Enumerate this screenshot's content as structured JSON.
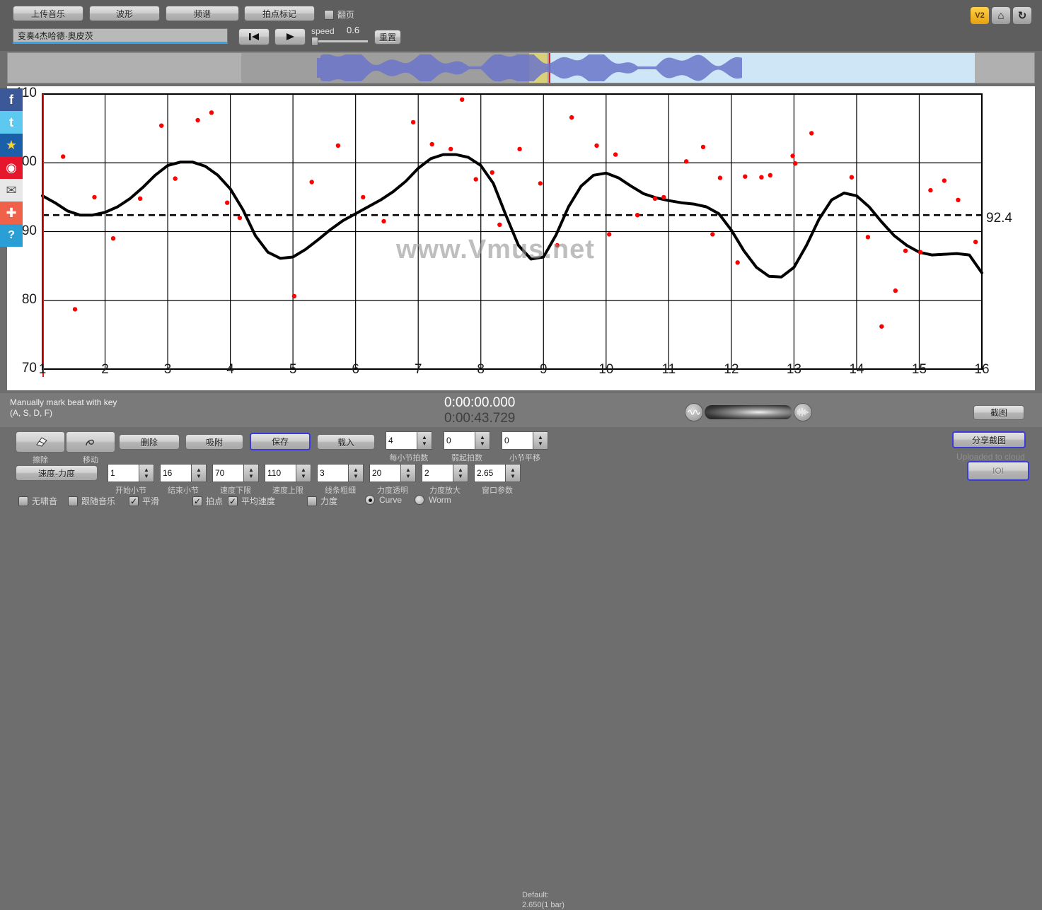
{
  "toolbar": {
    "tabs": [
      {
        "label": "上传音乐",
        "name": "upload-music"
      },
      {
        "label": "波形",
        "name": "waveform"
      },
      {
        "label": "频谱",
        "name": "spectrum"
      },
      {
        "label": "拍点标记",
        "name": "beat-marker"
      }
    ],
    "page_turn_label": "翻页",
    "page_turn_checked": false,
    "track_title": "变奏4杰哈德·奥皮茨",
    "speed_label": "speed",
    "speed_value": "0.6",
    "reset_label": "重置",
    "corner_v2": "V2",
    "corner_home": "⌂",
    "corner_refresh": "↻"
  },
  "status": {
    "hint_line1": "Manually mark beat with key",
    "hint_line2": "(A, S, D, F)",
    "time_current": "0:00:00.000",
    "time_total": "0:00:43.729",
    "snapshot_label": "截图"
  },
  "tools": [
    {
      "label": "擦除",
      "name": "erase",
      "icon": "eraser-icon"
    },
    {
      "label": "移动",
      "name": "move",
      "icon": "move-icon"
    }
  ],
  "buttons": {
    "delete": "删除",
    "snap": "吸附",
    "save": "保存",
    "load": "载入",
    "tempo_dynamics": "速度-力度",
    "share_snapshot": "分享截图",
    "uploaded": "Uploaded to cloud",
    "ioi": "IOI"
  },
  "spinners_row1": [
    {
      "name": "beats-per-bar",
      "value": "4",
      "caption": "每小节拍数"
    },
    {
      "name": "pickup-beats",
      "value": "0",
      "caption": "弱起拍数"
    },
    {
      "name": "bar-shift",
      "value": "0",
      "caption": "小节平移"
    }
  ],
  "spinners_row2": [
    {
      "name": "start-bar",
      "value": "1",
      "caption": "开始小节"
    },
    {
      "name": "end-bar",
      "value": "16",
      "caption": "结束小节"
    },
    {
      "name": "tempo-min",
      "value": "70",
      "caption": "速度下限"
    },
    {
      "name": "tempo-max",
      "value": "110",
      "caption": "速度上限"
    },
    {
      "name": "line-thickness",
      "value": "3",
      "caption": "线条粗细"
    },
    {
      "name": "dynamics-opacity",
      "value": "20",
      "caption": "力度透明"
    },
    {
      "name": "dynamics-scale",
      "value": "2",
      "caption": "力度放大"
    },
    {
      "name": "window-param",
      "value": "2.65",
      "caption": "窗口参数"
    }
  ],
  "default_note_line1": "Default:",
  "default_note_line2": "2.650(1 bar)",
  "checkboxes": [
    {
      "name": "no-whistle",
      "label": "无啸音",
      "checked": false
    },
    {
      "name": "follow-music",
      "label": "跟随音乐",
      "checked": false
    },
    {
      "name": "smooth",
      "label": "平滑",
      "checked": true
    },
    {
      "name": "beat",
      "label": "拍点",
      "checked": true
    },
    {
      "name": "average-tempo",
      "label": "平均速度",
      "checked": true
    },
    {
      "name": "dynamics",
      "label": "力度",
      "checked": false
    }
  ],
  "radios": [
    {
      "name": "curve",
      "label": "Curve",
      "selected": true
    },
    {
      "name": "worm",
      "label": "Worm",
      "selected": false
    }
  ],
  "social": [
    {
      "name": "facebook-icon",
      "glyph": "f",
      "color": "#3b5998"
    },
    {
      "name": "twitter-icon",
      "glyph": "t",
      "color": "#5ec9f0"
    },
    {
      "name": "qzone-icon",
      "glyph": "★",
      "color": "#1b5fa8"
    },
    {
      "name": "weibo-icon",
      "glyph": "◉",
      "color": "#e6162d"
    },
    {
      "name": "email-icon",
      "glyph": "✉",
      "color": "#e8e8e8"
    },
    {
      "name": "gplus-icon",
      "glyph": "✚",
      "color": "#f0614a"
    },
    {
      "name": "help-icon",
      "glyph": "?",
      "color": "#2a9fd6"
    }
  ],
  "watermark": "www.Vmus.net",
  "chart_data": {
    "type": "line",
    "title": "",
    "xlabel": "",
    "ylabel": "",
    "xlim": [
      1,
      16
    ],
    "ylim": [
      70,
      110
    ],
    "grid": true,
    "legend": "none",
    "xticks": [
      1,
      2,
      3,
      4,
      5,
      6,
      7,
      8,
      9,
      10,
      11,
      12,
      13,
      14,
      15,
      16
    ],
    "yticks": [
      70,
      80,
      90,
      100,
      110
    ],
    "mean_line": {
      "value": 92.4,
      "label": "92.4",
      "style": "dashed",
      "color": "#000000"
    },
    "series": [
      {
        "name": "tempo-curve",
        "type": "line",
        "color": "#000000",
        "points": [
          [
            1.0,
            95.2
          ],
          [
            1.2,
            94.2
          ],
          [
            1.4,
            93.0
          ],
          [
            1.6,
            92.4
          ],
          [
            1.8,
            92.4
          ],
          [
            2.0,
            92.8
          ],
          [
            2.2,
            93.6
          ],
          [
            2.4,
            94.8
          ],
          [
            2.6,
            96.4
          ],
          [
            2.8,
            98.2
          ],
          [
            3.0,
            99.6
          ],
          [
            3.2,
            100.1
          ],
          [
            3.4,
            100.1
          ],
          [
            3.6,
            99.5
          ],
          [
            3.8,
            98.2
          ],
          [
            4.0,
            96.2
          ],
          [
            4.2,
            93.2
          ],
          [
            4.4,
            89.4
          ],
          [
            4.6,
            87.0
          ],
          [
            4.8,
            86.1
          ],
          [
            5.0,
            86.3
          ],
          [
            5.2,
            87.4
          ],
          [
            5.4,
            88.8
          ],
          [
            5.6,
            90.3
          ],
          [
            5.8,
            91.6
          ],
          [
            6.0,
            92.6
          ],
          [
            6.2,
            93.6
          ],
          [
            6.4,
            94.6
          ],
          [
            6.6,
            95.8
          ],
          [
            6.8,
            97.3
          ],
          [
            7.0,
            99.2
          ],
          [
            7.2,
            100.6
          ],
          [
            7.4,
            101.2
          ],
          [
            7.6,
            101.2
          ],
          [
            7.8,
            100.8
          ],
          [
            8.0,
            99.6
          ],
          [
            8.2,
            97.0
          ],
          [
            8.4,
            92.4
          ],
          [
            8.6,
            88.0
          ],
          [
            8.8,
            86.0
          ],
          [
            9.0,
            86.3
          ],
          [
            9.2,
            89.5
          ],
          [
            9.4,
            93.6
          ],
          [
            9.6,
            96.6
          ],
          [
            9.8,
            98.2
          ],
          [
            10.0,
            98.5
          ],
          [
            10.2,
            97.8
          ],
          [
            10.4,
            96.6
          ],
          [
            10.6,
            95.5
          ],
          [
            10.8,
            94.9
          ],
          [
            11.0,
            94.5
          ],
          [
            11.2,
            94.2
          ],
          [
            11.4,
            94.0
          ],
          [
            11.6,
            93.6
          ],
          [
            11.8,
            92.6
          ],
          [
            12.0,
            90.2
          ],
          [
            12.2,
            87.2
          ],
          [
            12.4,
            84.8
          ],
          [
            12.6,
            83.5
          ],
          [
            12.8,
            83.4
          ],
          [
            13.0,
            84.8
          ],
          [
            13.2,
            88.0
          ],
          [
            13.4,
            91.8
          ],
          [
            13.6,
            94.6
          ],
          [
            13.8,
            95.6
          ],
          [
            14.0,
            95.2
          ],
          [
            14.2,
            93.6
          ],
          [
            14.4,
            91.4
          ],
          [
            14.6,
            89.4
          ],
          [
            14.8,
            88.0
          ],
          [
            15.0,
            87.0
          ],
          [
            15.2,
            86.6
          ],
          [
            15.4,
            86.7
          ],
          [
            15.6,
            86.8
          ],
          [
            15.8,
            86.6
          ],
          [
            16.0,
            84.0
          ]
        ]
      },
      {
        "name": "beat-points",
        "type": "scatter",
        "color": "#ff0000",
        "points": [
          [
            1.33,
            100.9
          ],
          [
            1.52,
            78.7
          ],
          [
            1.83,
            95.0
          ],
          [
            2.13,
            89.0
          ],
          [
            2.56,
            94.8
          ],
          [
            2.9,
            105.4
          ],
          [
            3.12,
            97.7
          ],
          [
            3.48,
            106.2
          ],
          [
            3.7,
            107.3
          ],
          [
            3.95,
            94.2
          ],
          [
            4.15,
            92.0
          ],
          [
            5.02,
            80.6
          ],
          [
            5.3,
            97.2
          ],
          [
            5.72,
            102.5
          ],
          [
            6.12,
            95.0
          ],
          [
            6.45,
            91.5
          ],
          [
            6.92,
            105.9
          ],
          [
            7.22,
            102.7
          ],
          [
            7.52,
            102.0
          ],
          [
            7.7,
            109.2
          ],
          [
            7.92,
            97.6
          ],
          [
            8.18,
            98.6
          ],
          [
            8.62,
            102.0
          ],
          [
            8.95,
            97.0
          ],
          [
            9.45,
            106.6
          ],
          [
            9.85,
            102.5
          ],
          [
            10.15,
            101.2
          ],
          [
            10.5,
            92.4
          ],
          [
            10.78,
            94.8
          ],
          [
            10.92,
            95.0
          ],
          [
            11.28,
            100.2
          ],
          [
            11.55,
            102.3
          ],
          [
            11.82,
            97.8
          ],
          [
            11.7,
            89.6
          ],
          [
            12.22,
            98.0
          ],
          [
            12.48,
            97.9
          ],
          [
            12.62,
            98.2
          ],
          [
            12.98,
            101.0
          ],
          [
            13.02,
            99.9
          ],
          [
            13.28,
            104.3
          ],
          [
            13.92,
            97.9
          ],
          [
            14.18,
            89.2
          ],
          [
            14.4,
            76.2
          ],
          [
            14.62,
            81.4
          ],
          [
            14.78,
            87.2
          ],
          [
            15.02,
            87.0
          ],
          [
            15.18,
            96.0
          ],
          [
            15.4,
            97.4
          ],
          [
            15.62,
            94.6
          ],
          [
            15.9,
            88.5
          ],
          [
            9.22,
            88.0
          ],
          [
            10.05,
            89.6
          ],
          [
            12.1,
            85.5
          ],
          [
            8.3,
            91.0
          ]
        ]
      }
    ]
  }
}
